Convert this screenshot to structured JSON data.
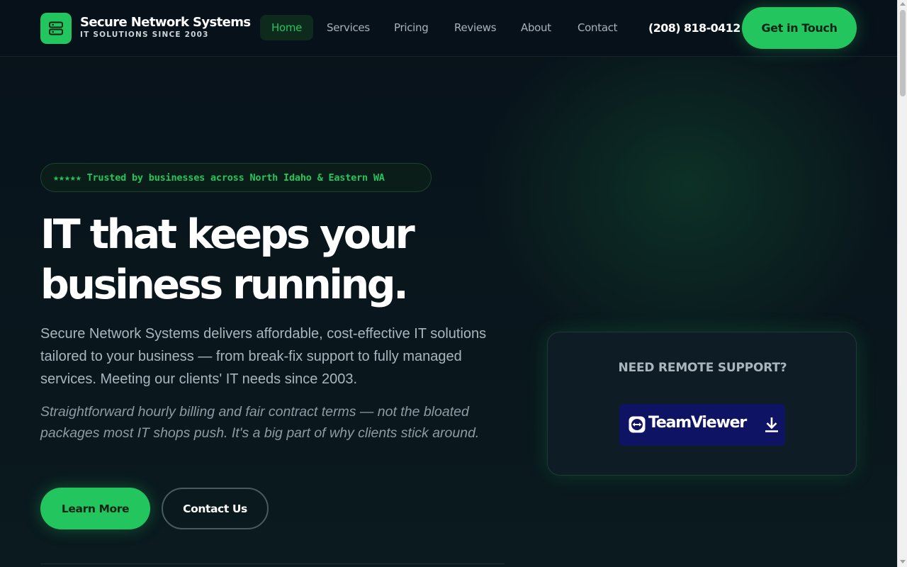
{
  "brand": {
    "name": "Secure Network Systems",
    "tagline": "IT SOLUTIONS SINCE 2003",
    "accent_color": "#22c55e",
    "logo_icon": "server-icon"
  },
  "nav": {
    "items": [
      {
        "label": "Home",
        "active": true
      },
      {
        "label": "Services",
        "active": false
      },
      {
        "label": "Pricing",
        "active": false
      },
      {
        "label": "Reviews",
        "active": false
      },
      {
        "label": "About",
        "active": false
      },
      {
        "label": "Contact",
        "active": false
      }
    ],
    "phone": "(208) 818-0412",
    "cta_label": "Get in Touch"
  },
  "hero": {
    "badge": "★★★★★ Trusted by businesses across North Idaho & Eastern WA",
    "title_line1": "IT that keeps your",
    "title_line2": "business running.",
    "description": "Secure Network Systems delivers affordable, cost-effective IT solutions tailored to your business — from break-fix support to fully managed services. Meeting our clients' IT needs since 2003.",
    "note": "Straightforward hourly billing and fair contract terms — not the bloated packages most IT shops push. It's a big part of why clients stick around.",
    "primary_button": "Learn More",
    "secondary_button": "Contact Us"
  },
  "support": {
    "title": "NEED REMOTE SUPPORT?",
    "button_label": "TeamViewer",
    "button_color": "#0e1463",
    "logo_icon": "teamviewer-icon",
    "action_icon": "download-icon"
  }
}
